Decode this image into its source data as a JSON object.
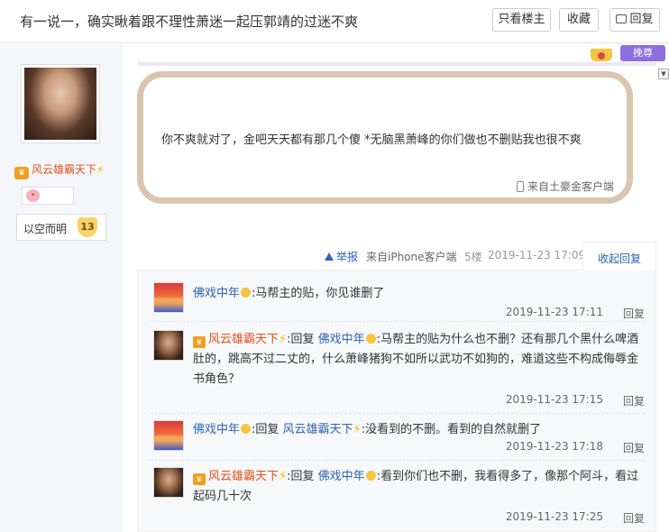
{
  "header": {
    "title": "有一说一，确实瞅着跟不理性萧迷一起压郭靖的过迷不爽",
    "btn_only_author": "只看楼主",
    "btn_collect": "收藏",
    "btn_reply": "回复"
  },
  "author": {
    "name": "风云雄霸天下",
    "badge_text": "以空而明",
    "badge_level": "13"
  },
  "badges": {
    "huanzun": "挽尊"
  },
  "post": {
    "content": "你不爽就对了，金吧天天都有那几个傻 *无脑黑萧峰的你们做也不删贴我也很不爽",
    "client": "来自土豪金客户端"
  },
  "meta": {
    "report": "举报",
    "from": "来自iPhone客户端",
    "floor": "5楼",
    "time": "2019-11-23 17:09",
    "fold": "收起回复"
  },
  "replies": [
    {
      "user": "佛戏中年",
      "prefix": "",
      "target": "",
      "text": ":马帮主的贴，你见谁删了",
      "time": "2019-11-23 17:11",
      "reply": "回复"
    },
    {
      "user": "风云雄霸天下",
      "prefix": ":回复 ",
      "target": "佛戏中年",
      "text": ":马帮主的贴为什么也不删？还有那几个黑什么啤酒肚的，跳高不过二丈的，什么萧峰猪狗不如所以武功不如狗的，难道这些不构成侮辱金书角色？",
      "time": "2019-11-23 17:15",
      "reply": "回复"
    },
    {
      "user": "佛戏中年",
      "prefix": ":回复 ",
      "target": "风云雄霸天下",
      "text": ":没看到的不删。看到的自然就删了",
      "time": "2019-11-23 17:18",
      "reply": "回复"
    },
    {
      "user": "风云雄霸天下",
      "prefix": ":回复 ",
      "target": "佛戏中年",
      "text": ":看到你们也不删，我看得多了，像那个阿斗，看过起码几十次",
      "time": "2019-11-23 17:25",
      "reply": "回复"
    }
  ]
}
